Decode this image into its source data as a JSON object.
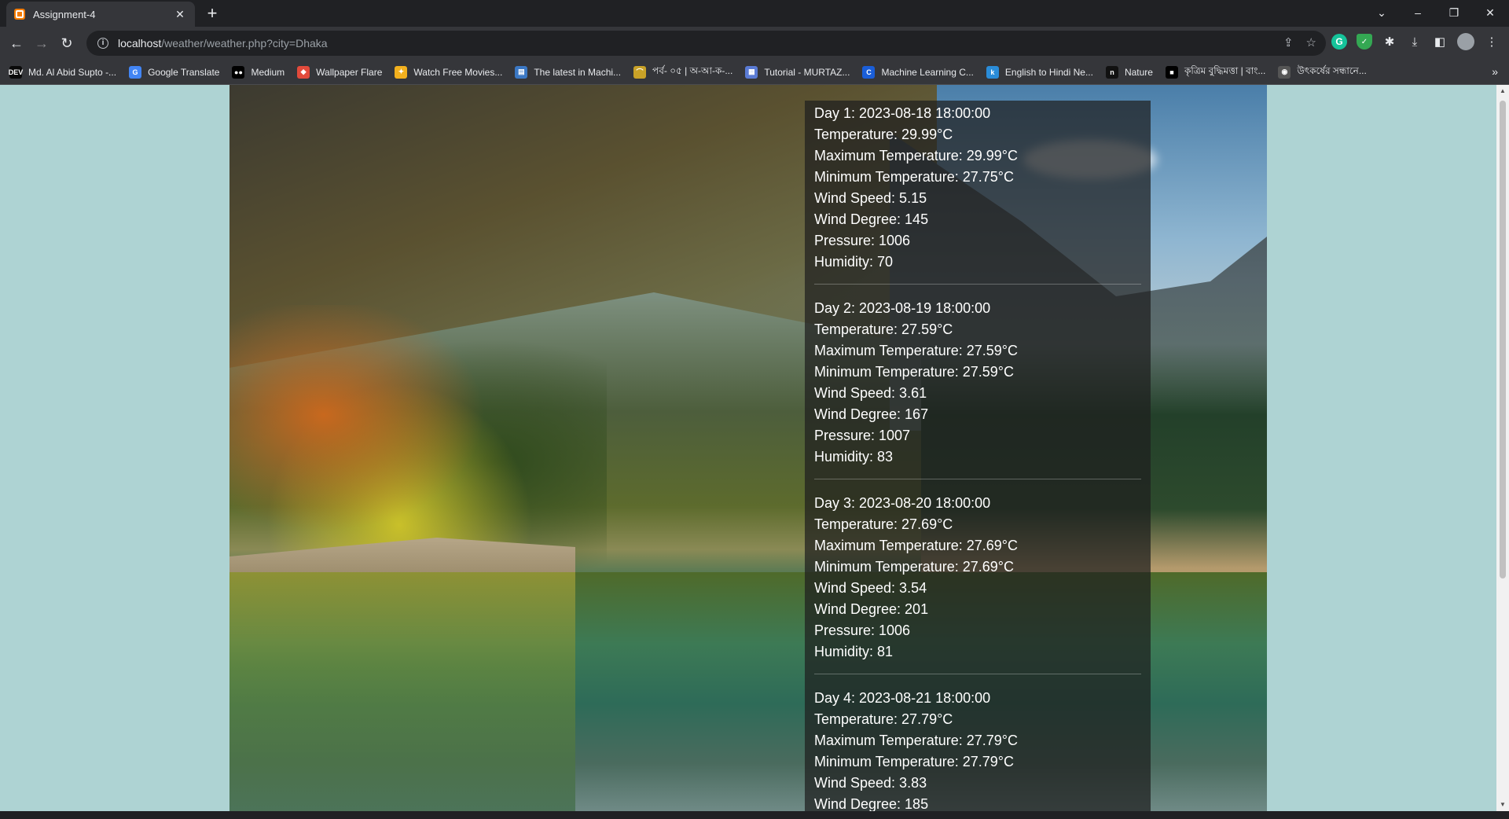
{
  "browser": {
    "tab": {
      "title": "Assignment-4",
      "close": "✕"
    },
    "new_tab": "+",
    "window_controls": {
      "tabs_menu": "⌄",
      "minimize": "–",
      "restore": "❐",
      "close": "✕"
    },
    "nav": {
      "back": "←",
      "forward": "→",
      "reload": "↻"
    },
    "address": {
      "host": "localhost",
      "path": "/weather/weather.php?city=Dhaka"
    },
    "omnibox_icons": {
      "share": "⇪",
      "bookmark_star": "☆"
    },
    "extensions": {
      "grammarly": "G",
      "shield": "✓",
      "puzzle": "✱",
      "download": "⤓",
      "sidepanel": "◧",
      "menu": "⋮"
    },
    "bookmarks": [
      {
        "label": "Md. Al Abid Supto -...",
        "icon": "dev-icon",
        "icon_text": "DEV",
        "color": "#0a0a0a"
      },
      {
        "label": "Google Translate",
        "icon": "google-translate-icon",
        "icon_text": "G",
        "color": "#4285f4"
      },
      {
        "label": "Medium",
        "icon": "medium-icon",
        "icon_text": "●●",
        "color": "#000000"
      },
      {
        "label": "Wallpaper Flare",
        "icon": "flame-icon",
        "icon_text": "◆",
        "color": "#e24a3b"
      },
      {
        "label": "Watch Free Movies...",
        "icon": "popcorn-icon",
        "icon_text": "✦",
        "color": "#f2b01e"
      },
      {
        "label": "The latest in Machi...",
        "icon": "page-icon",
        "icon_text": "▤",
        "color": "#3b78c4"
      },
      {
        "label": "পর্ব- ০৫ | অ-আ-ক-...",
        "icon": "bird-icon",
        "icon_text": "⌒",
        "color": "#c9a227"
      },
      {
        "label": "Tutorial - MURTAZ...",
        "icon": "tutorial-icon",
        "icon_text": "▦",
        "color": "#5a7bd4"
      },
      {
        "label": "Machine Learning C...",
        "icon": "c-icon",
        "icon_text": "C",
        "color": "#1a5ed8"
      },
      {
        "label": "English to Hindi Ne...",
        "icon": "k-icon",
        "icon_text": "k",
        "color": "#2a8cd8"
      },
      {
        "label": "Nature",
        "icon": "nature-icon",
        "icon_text": "n",
        "color": "#111111"
      },
      {
        "label": "কৃত্রিম বুদ্ধিমত্তা | বাং...",
        "icon": "square-icon",
        "icon_text": "■",
        "color": "#000000"
      },
      {
        "label": "উৎকর্ষের সন্ধানে...",
        "icon": "circle-icon",
        "icon_text": "◉",
        "color": "#555555"
      }
    ],
    "bookmarks_more": "»"
  },
  "forecast": [
    {
      "day": "Day 1: 2023-08-18 18:00:00",
      "temperature": "Temperature: 29.99°C",
      "max": "Maximum Temperature: 29.99°C",
      "min": "Minimum Temperature: 27.75°C",
      "wind_speed": "Wind Speed: 5.15",
      "wind_degree": "Wind Degree: 145",
      "pressure": "Pressure: 1006",
      "humidity": "Humidity: 70"
    },
    {
      "day": "Day 2: 2023-08-19 18:00:00",
      "temperature": "Temperature: 27.59°C",
      "max": "Maximum Temperature: 27.59°C",
      "min": "Minimum Temperature: 27.59°C",
      "wind_speed": "Wind Speed: 3.61",
      "wind_degree": "Wind Degree: 167",
      "pressure": "Pressure: 1007",
      "humidity": "Humidity: 83"
    },
    {
      "day": "Day 3: 2023-08-20 18:00:00",
      "temperature": "Temperature: 27.69°C",
      "max": "Maximum Temperature: 27.69°C",
      "min": "Minimum Temperature: 27.69°C",
      "wind_speed": "Wind Speed: 3.54",
      "wind_degree": "Wind Degree: 201",
      "pressure": "Pressure: 1006",
      "humidity": "Humidity: 81"
    },
    {
      "day": "Day 4: 2023-08-21 18:00:00",
      "temperature": "Temperature: 27.79°C",
      "max": "Maximum Temperature: 27.79°C",
      "min": "Minimum Temperature: 27.79°C",
      "wind_speed": "Wind Speed: 3.83",
      "wind_degree": "Wind Degree: 185"
    }
  ],
  "scroll_position": 0.0
}
